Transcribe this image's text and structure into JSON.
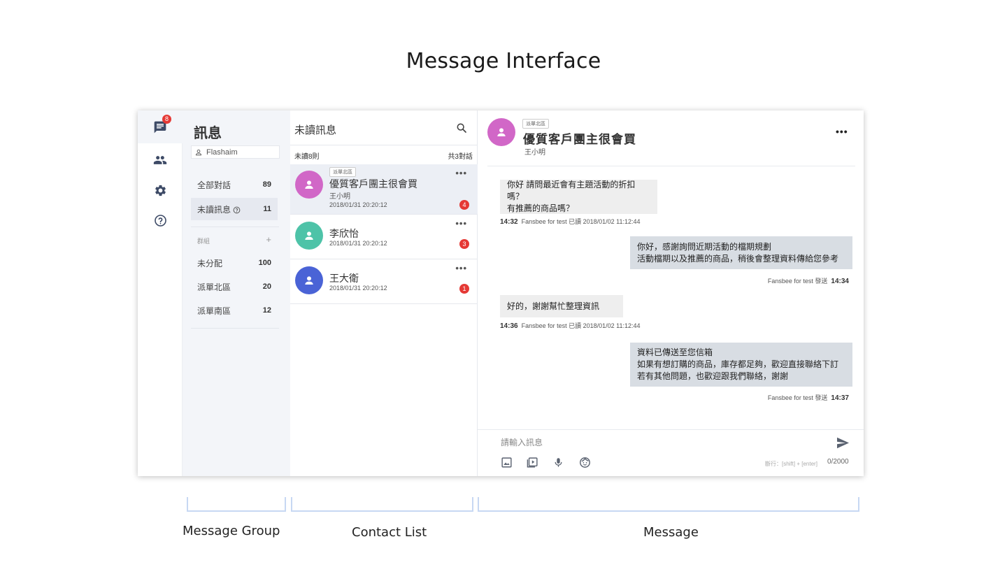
{
  "page_title": "Message Interface",
  "rail": {
    "messages_badge": "8",
    "icons": [
      "chat-icon",
      "people-icon",
      "gear-icon",
      "help-icon"
    ]
  },
  "groups": {
    "title": "訊息",
    "user": "Flashaim",
    "all_label": "全部對話",
    "all_count": "89",
    "unread_label": "未讀訊息",
    "unread_count": "11",
    "group_header": "群組",
    "add": "+",
    "items": [
      {
        "label": "未分配",
        "count": "100"
      },
      {
        "label": "派單北區",
        "count": "20"
      },
      {
        "label": "派單南區",
        "count": "12"
      }
    ]
  },
  "contacts": {
    "title": "未讀訊息",
    "unread_summary": "未讀8則",
    "total_summary": "共3對話",
    "items": [
      {
        "tag": "派單北區",
        "name": "優質客戶團主很會買",
        "sub": "王小明",
        "time": "2018/01/31 20:20:12",
        "badge": "4",
        "avatar_color": "#d167c7",
        "more": "•••"
      },
      {
        "name": "李欣怡",
        "time": "2018/01/31 20:20:12",
        "badge": "3",
        "avatar_color": "#4ec3a8",
        "more": "•••"
      },
      {
        "name": "王大衛",
        "time": "2018/01/31 20:20:12",
        "badge": "1",
        "avatar_color": "#4a63d6",
        "more": "•••"
      }
    ]
  },
  "chat": {
    "tag": "派單北區",
    "name": "優質客戶團主很會買",
    "sub": "王小明",
    "more": "•••",
    "messages": [
      {
        "dir": "in",
        "lines": [
          "你好 請問最近會有主題活動的折扣嗎？",
          "有推薦的商品嗎？"
        ],
        "time": "14:32",
        "status": "Fansbee for test 已讀 2018/01/02 11:12:44"
      },
      {
        "dir": "out",
        "lines": [
          "你好，感謝詢問近期活動的檔期規劃",
          "活動檔期以及推薦的商品，稍後會整理資料傳給您參考"
        ],
        "time": "14:34",
        "status": "Fansbee for test 發送"
      },
      {
        "dir": "in",
        "lines": [
          "好的，謝謝幫忙整理資訊"
        ],
        "time": "14:36",
        "status": "Fansbee for test 已讀 2018/01/02 11:12:44"
      },
      {
        "dir": "out",
        "lines": [
          "資料已傳送至您信箱",
          "如果有想訂購的商品，庫存都足夠，歡迎直接聯絡下訂",
          "若有其他問題，也歡迎跟我們聯絡，謝謝"
        ],
        "time": "14:37",
        "status": "Fansbee for test 發送"
      }
    ],
    "input_placeholder": "請輸入訊息",
    "newline_hint": "斷行：[shift] + [enter]",
    "char_count": "0/2000"
  },
  "sections": [
    "Message Group",
    "Contact List",
    "Message"
  ],
  "colors": {
    "badge": "#e53935",
    "bracket": "#c7d8f3",
    "panel_bg": "#f3f5f9"
  }
}
